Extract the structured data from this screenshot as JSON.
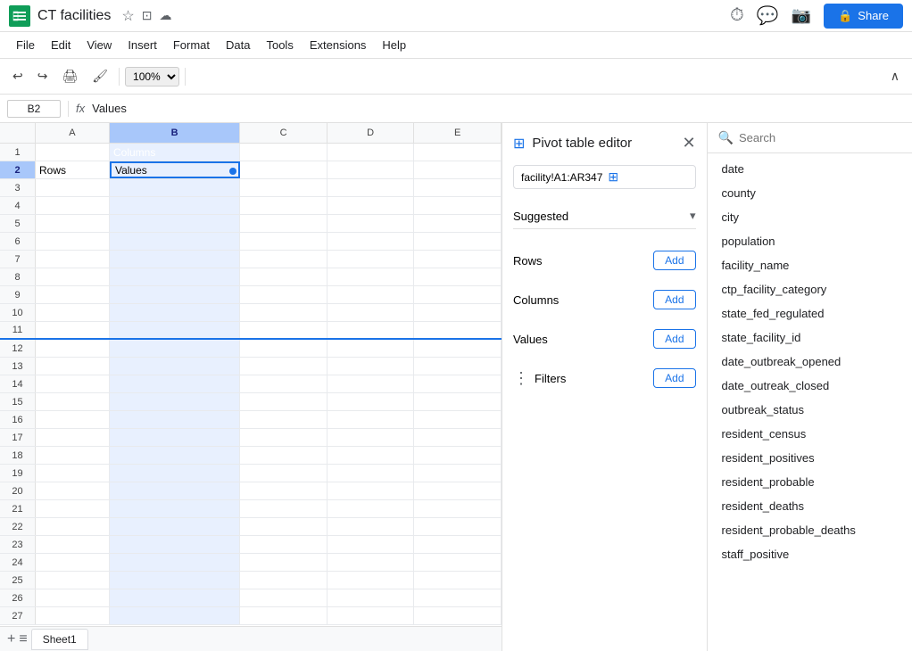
{
  "app": {
    "title": "CT facilities",
    "icon_color": "#0f9d58"
  },
  "menu": {
    "items": [
      "File",
      "Edit",
      "View",
      "Insert",
      "Format",
      "Data",
      "Tools",
      "Extensions",
      "Help"
    ]
  },
  "toolbar": {
    "zoom": "100%"
  },
  "formula_bar": {
    "cell_ref": "B2",
    "formula_label": "fx",
    "value": "Values"
  },
  "spreadsheet": {
    "columns": [
      "",
      "A",
      "B",
      "C",
      "D",
      "E"
    ],
    "rows": [
      {
        "num": "1",
        "a": "",
        "b": "Columns",
        "c": "",
        "d": "",
        "e": ""
      },
      {
        "num": "2",
        "a": "Rows",
        "b": "Values",
        "c": "",
        "d": "",
        "e": ""
      },
      {
        "num": "3",
        "a": "",
        "b": "",
        "c": "",
        "d": "",
        "e": ""
      },
      {
        "num": "4",
        "a": "",
        "b": "",
        "c": "",
        "d": "",
        "e": ""
      },
      {
        "num": "5",
        "a": "",
        "b": "",
        "c": "",
        "d": "",
        "e": ""
      },
      {
        "num": "6",
        "a": "",
        "b": "",
        "c": "",
        "d": "",
        "e": ""
      },
      {
        "num": "7",
        "a": "",
        "b": "",
        "c": "",
        "d": "",
        "e": ""
      },
      {
        "num": "8",
        "a": "",
        "b": "",
        "c": "",
        "d": "",
        "e": ""
      },
      {
        "num": "9",
        "a": "",
        "b": "",
        "c": "",
        "d": "",
        "e": ""
      },
      {
        "num": "10",
        "a": "",
        "b": "",
        "c": "",
        "d": "",
        "e": ""
      },
      {
        "num": "11",
        "a": "",
        "b": "",
        "c": "",
        "d": "",
        "e": ""
      },
      {
        "num": "12",
        "a": "",
        "b": "",
        "c": "",
        "d": "",
        "e": ""
      },
      {
        "num": "13",
        "a": "",
        "b": "",
        "c": "",
        "d": "",
        "e": ""
      },
      {
        "num": "14",
        "a": "",
        "b": "",
        "c": "",
        "d": "",
        "e": ""
      },
      {
        "num": "15",
        "a": "",
        "b": "",
        "c": "",
        "d": "",
        "e": ""
      },
      {
        "num": "16",
        "a": "",
        "b": "",
        "c": "",
        "d": "",
        "e": ""
      },
      {
        "num": "17",
        "a": "",
        "b": "",
        "c": "",
        "d": "",
        "e": ""
      },
      {
        "num": "18",
        "a": "",
        "b": "",
        "c": "",
        "d": "",
        "e": ""
      },
      {
        "num": "19",
        "a": "",
        "b": "",
        "c": "",
        "d": "",
        "e": ""
      },
      {
        "num": "20",
        "a": "",
        "b": "",
        "c": "",
        "d": "",
        "e": ""
      },
      {
        "num": "21",
        "a": "",
        "b": "",
        "c": "",
        "d": "",
        "e": ""
      },
      {
        "num": "22",
        "a": "",
        "b": "",
        "c": "",
        "d": "",
        "e": ""
      },
      {
        "num": "23",
        "a": "",
        "b": "",
        "c": "",
        "d": "",
        "e": ""
      },
      {
        "num": "24",
        "a": "",
        "b": "",
        "c": "",
        "d": "",
        "e": ""
      },
      {
        "num": "25",
        "a": "",
        "b": "",
        "c": "",
        "d": "",
        "e": ""
      },
      {
        "num": "26",
        "a": "",
        "b": "",
        "c": "",
        "d": "",
        "e": ""
      },
      {
        "num": "27",
        "a": "",
        "b": "",
        "c": "",
        "d": "",
        "e": ""
      }
    ]
  },
  "pivot_editor": {
    "title": "Pivot table editor",
    "data_range": "facility!A1:AR347",
    "suggested_label": "Suggested",
    "rows_label": "Rows",
    "columns_label": "Columns",
    "values_label": "Values",
    "filters_label": "Filters",
    "add_label": "Add"
  },
  "field_list": {
    "search_placeholder": "Search",
    "fields": [
      "date",
      "county",
      "city",
      "population",
      "facility_name",
      "ctp_facility_category",
      "state_fed_regulated",
      "state_facility_id",
      "date_outbreak_opened",
      "date_outreak_closed",
      "outbreak_status",
      "resident_census",
      "resident_positives",
      "resident_probable",
      "resident_deaths",
      "resident_probable_deaths",
      "staff_positive"
    ]
  },
  "sheet_tabs": [
    "Sheet1"
  ]
}
